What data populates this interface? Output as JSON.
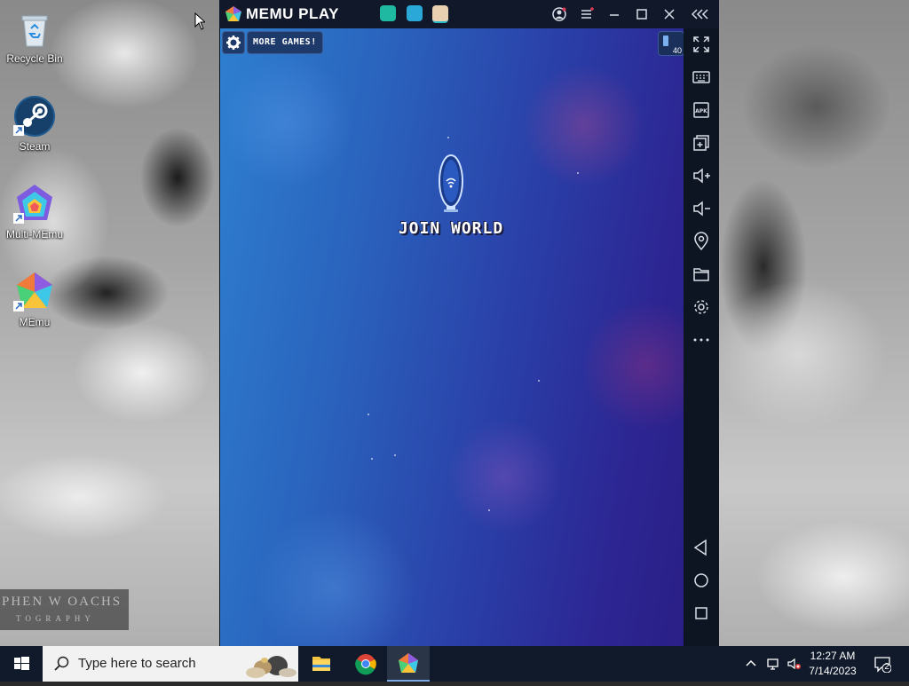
{
  "desktop": {
    "icons": [
      {
        "label": "Recycle Bin"
      },
      {
        "label": "Steam"
      },
      {
        "label": "Multi-MEmu"
      },
      {
        "label": "MEmu"
      }
    ],
    "watermark": {
      "line1": "PHEN W OACHS",
      "line2": "TOGRAPHY"
    }
  },
  "emulator": {
    "title": "MEMU PLAY",
    "accent": "#2a63bd",
    "game": {
      "more_games": "MORE GAMES!",
      "fps_value": "40",
      "join_label": "JOIN WORLD"
    },
    "sidebar_icons": [
      "fullscreen-icon",
      "keyboard-icon",
      "apk-icon",
      "multi-window-icon",
      "volume-up-icon",
      "volume-down-icon",
      "location-icon",
      "folder-icon",
      "settings-icon",
      "more-icon",
      "back-icon",
      "home-icon",
      "recents-icon"
    ]
  },
  "taskbar": {
    "search_placeholder": "Type here to search",
    "time": "12:27 AM",
    "date": "7/14/2023",
    "notification_count": "2"
  }
}
